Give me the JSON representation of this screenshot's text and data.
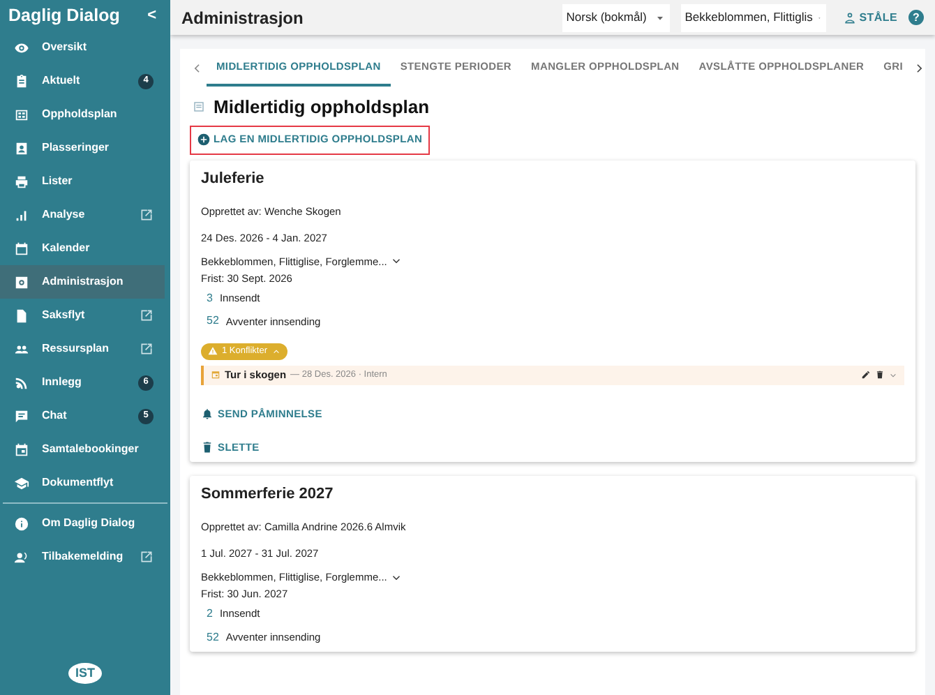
{
  "sidebar": {
    "title": "Daglig Dialog",
    "collapse_label": "<",
    "items": [
      {
        "label": "Oversikt",
        "selected": false
      },
      {
        "label": "Aktuelt",
        "selected": false,
        "badge": "4"
      },
      {
        "label": "Oppholdsplan",
        "selected": false
      },
      {
        "label": "Plasseringer",
        "selected": false
      },
      {
        "label": "Lister",
        "selected": false
      },
      {
        "label": "Analyse",
        "selected": false,
        "external": true
      },
      {
        "label": "Kalender",
        "selected": false
      },
      {
        "label": "Administrasjon",
        "selected": true
      },
      {
        "label": "Saksflyt",
        "selected": false,
        "external": true
      },
      {
        "label": "Ressursplan",
        "selected": false,
        "external": true
      },
      {
        "label": "Innlegg",
        "selected": false,
        "badge": "6"
      },
      {
        "label": "Chat",
        "selected": false,
        "badge": "5"
      },
      {
        "label": "Samtalebookinger",
        "selected": false
      },
      {
        "label": "Dokumentflyt",
        "selected": false
      }
    ],
    "footer_items": [
      {
        "label": "Om Daglig Dialog",
        "selected": false
      },
      {
        "label": "Tilbakemelding",
        "selected": false,
        "external": true
      }
    ],
    "logo": "IST"
  },
  "header": {
    "title": "Administrasjon",
    "language": "Norsk (bokmål)",
    "unit": "Bekkeblommen, Flittiglis",
    "user": "STÅLE",
    "help": "?"
  },
  "tabs": [
    {
      "label": "MIDLERTIDIG OPPHOLDSPLAN",
      "selected": true
    },
    {
      "label": "STENGTE PERIODER",
      "selected": false
    },
    {
      "label": "MANGLER OPPHOLDSPLAN",
      "selected": false
    },
    {
      "label": "AVSLÅTTE OPPHOLDSPLANER",
      "selected": false
    },
    {
      "label": "GRI",
      "selected": false
    }
  ],
  "page_title": "Midlertidig oppholdsplan",
  "create_button": "LAG EN MIDLERTIDIG OPPHOLDSPLAN",
  "plans": [
    {
      "title": "Juleferie",
      "created_by": "Opprettet av: Wenche Skogen",
      "period": "24 Des. 2026 - 4 Jan. 2027",
      "units": "Bekkeblommen, Flittiglise, Forglemme...",
      "deadline": "Frist: 30 Sept. 2026",
      "submitted_count": "3",
      "submitted_label": "Innsendt",
      "waiting_count": "52",
      "waiting_label": "Avventer innsending",
      "conflict_badge": "1 Konflikter",
      "conflicts": [
        {
          "title": "Tur i skogen",
          "detail": "— 28 Des. 2026 · Intern"
        }
      ],
      "actions": [
        "SEND PÅMINNELSE",
        "SLETTE"
      ]
    },
    {
      "title": "Sommerferie 2027",
      "created_by": "Opprettet av: Camilla Andrine 2026.6 Almvik",
      "period": "1 Jul. 2027 - 31 Jul. 2027",
      "units": "Bekkeblommen, Flittiglise, Forglemme...",
      "deadline": "Frist: 30 Jun. 2027",
      "submitted_count": "2",
      "submitted_label": "Innsendt",
      "waiting_count": "52",
      "waiting_label": "Avventer innsending"
    }
  ]
}
